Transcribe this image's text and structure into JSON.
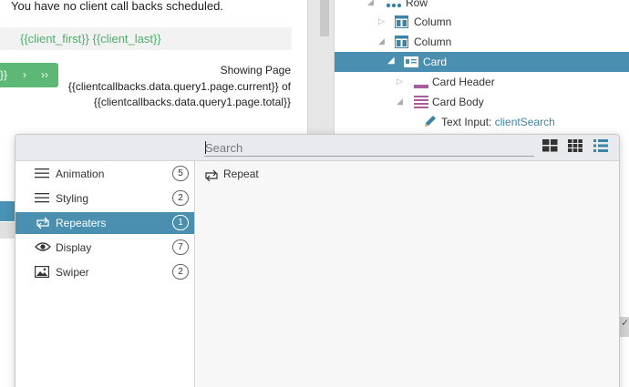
{
  "preview": {
    "no_callbacks_msg": "You have no client call backs scheduled.",
    "client_name": "{{client_first}} {{client_last}}",
    "pager_left": "}}",
    "pager_next": "›",
    "pager_last": "››",
    "showing_line1": "Showing Page",
    "showing_line2": "{{clientcallbacks.data.query1.page.current}} of",
    "showing_line3": "{{clientcallbacks.data.query1.page.total}}"
  },
  "tree": {
    "rows": [
      {
        "label": "Row"
      },
      {
        "label": "Column"
      },
      {
        "label": "Column"
      },
      {
        "label": "Card"
      },
      {
        "label": "Card Header"
      },
      {
        "label": "Card Body"
      },
      {
        "label_prefix": "Text Input: ",
        "label_value": "clientSearch"
      }
    ],
    "check_mark": "✓"
  },
  "dialog": {
    "search": {
      "placeholder": "Search",
      "value": ""
    },
    "view_buttons": [
      "large-grid-icon",
      "small-grid-icon",
      "list-icon"
    ],
    "active_view": "list-icon",
    "categories": [
      {
        "label": "Animation",
        "count": "5",
        "icon": "lines-icon"
      },
      {
        "label": "Styling",
        "count": "2",
        "icon": "lines-icon"
      },
      {
        "label": "Repeaters",
        "count": "1",
        "icon": "repeat-icon",
        "selected": true
      },
      {
        "label": "Display",
        "count": "7",
        "icon": "eye-icon"
      },
      {
        "label": "Swiper",
        "count": "2",
        "icon": "image-icon"
      }
    ],
    "items": [
      {
        "label": "Repeat",
        "icon": "repeat-icon"
      }
    ]
  },
  "colors": {
    "selection": "#4a8fb0",
    "accent_green": "#5cb874",
    "link_blue": "#3b84a8"
  }
}
